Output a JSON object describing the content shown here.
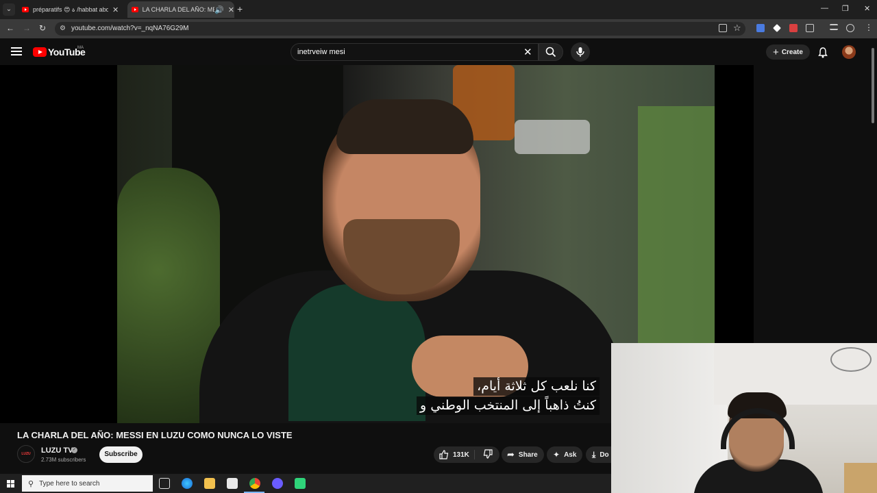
{
  "browser": {
    "tabs": [
      {
        "title": "préparatifs 😍 ة /habbat abdel",
        "active": false
      },
      {
        "title": "LA CHARLA DEL AÑO: MES",
        "active": true
      }
    ],
    "url": "youtube.com/watch?v=_nqNA76G29M",
    "icons": [
      "tab-search-icon",
      "close-icon",
      "new-tab-icon",
      "minimize-icon",
      "restore-icon",
      "close-window-icon",
      "back-icon",
      "forward-icon",
      "reload-icon",
      "site-info-icon",
      "install-app-icon",
      "bookmark-star-icon",
      "extensions-icon",
      "profile-icon",
      "menu-icon"
    ]
  },
  "youtube": {
    "logo_text": "YouTube",
    "region": "MA",
    "search_value": "inetrveiw mesi",
    "create_label": "Create"
  },
  "video": {
    "subtitle_line1": "كنا نلعب كل ثلاثة أيام،",
    "subtitle_line2": "كنتُ ذاهباً إلى المنتخب الوطني و",
    "title": "LA CHARLA DEL AÑO: MESSI EN LUZU COMO NUNCA LO VISTE"
  },
  "channel": {
    "avatar_text": "LUZU",
    "name": "LUZU TV",
    "verified": "✓",
    "subscribers": "2.73M subscribers",
    "subscribe_label": "Subscribe"
  },
  "actions": {
    "likes": "131K",
    "share_label": "Share",
    "ask_label": "Ask",
    "download_label": "Do"
  },
  "taskbar": {
    "search_placeholder": "Type here to search"
  },
  "colors": {
    "yt_red": "#ff0000",
    "background": "#0f0f0f",
    "chip": "#272727"
  }
}
